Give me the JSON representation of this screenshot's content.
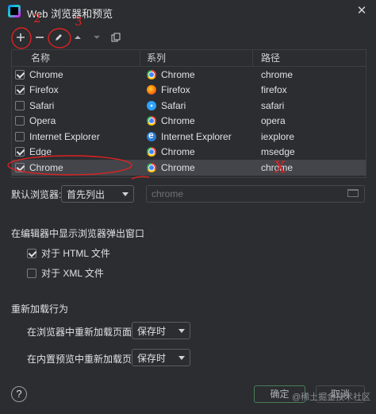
{
  "window": {
    "title": "Web 浏览器和预览",
    "close_glyph": "✕"
  },
  "toolbar": {
    "icons": [
      "plus-icon",
      "minus-icon",
      "edit-icon",
      "up-arrow-icon",
      "down-arrow-icon",
      "copy-icon"
    ]
  },
  "table": {
    "headers": [
      "名称",
      "系列",
      "路径"
    ],
    "rows": [
      {
        "checked": true,
        "name": "Chrome",
        "family": "Chrome",
        "path": "chrome",
        "icon": "chrome-icon"
      },
      {
        "checked": true,
        "name": "Firefox",
        "family": "Firefox",
        "path": "firefox",
        "icon": "firefox-icon"
      },
      {
        "checked": false,
        "name": "Safari",
        "family": "Safari",
        "path": "safari",
        "icon": "safari-icon"
      },
      {
        "checked": false,
        "name": "Opera",
        "family": "Chrome",
        "path": "opera",
        "icon": "chrome-icon"
      },
      {
        "checked": false,
        "name": "Internet Explorer",
        "family": "Internet Explorer",
        "path": "iexplore",
        "icon": "ie-icon"
      },
      {
        "checked": true,
        "name": "Edge",
        "family": "Chrome",
        "path": "msedge",
        "icon": "chrome-icon"
      },
      {
        "checked": true,
        "name": "Chrome",
        "family": "Chrome",
        "path": "chrome",
        "icon": "chrome-icon",
        "selected": true
      }
    ]
  },
  "default_browser": {
    "label": "默认浏览器:",
    "value": "首先列出",
    "path_placeholder": "chrome"
  },
  "popup_section": {
    "title": "在编辑器中显示浏览器弹出窗口",
    "options": [
      {
        "label": "对于 HTML 文件",
        "checked": true
      },
      {
        "label": "对于 XML 文件",
        "checked": false
      }
    ]
  },
  "reload_section": {
    "title": "重新加载行为",
    "in_browser_label": "在浏览器中重新加载页面:",
    "in_browser_value": "保存时",
    "in_preview_label": "在内置预览中重新加载页面:",
    "in_preview_value": "保存时"
  },
  "footer": {
    "help": "?",
    "ok": "确定",
    "cancel": "取消",
    "watermark": "@稀土掘金技术社区"
  },
  "annotations": {
    "num2": "2",
    "num3": "3",
    "cross": "X",
    "color": "#dd2222"
  },
  "colors": {
    "background": "#2b2d30",
    "selected_row": "#43454a",
    "ok_border": "#4c7e58"
  }
}
